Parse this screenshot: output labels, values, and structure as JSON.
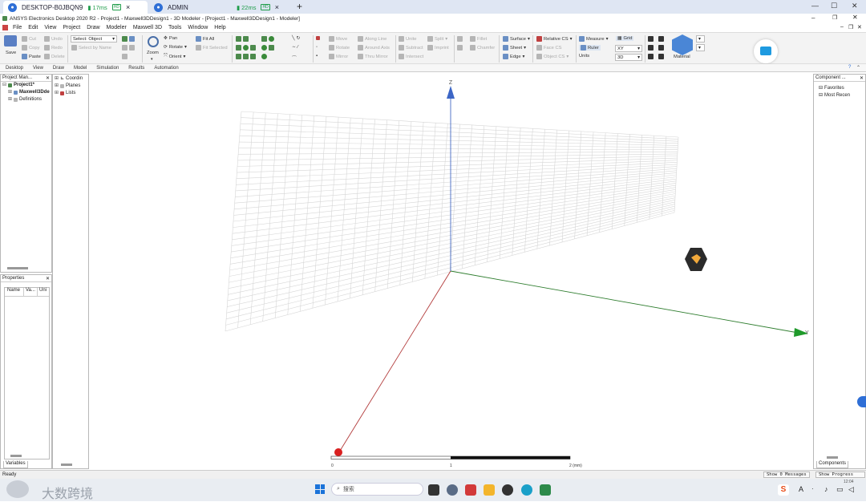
{
  "remote_tabs": [
    {
      "label": "DESKTOP-B0JBQN9",
      "ping": "17ms",
      "quality": "HD",
      "close": "×"
    },
    {
      "label": "ADMIN",
      "ping": "22ms",
      "quality": "HD",
      "close": "×"
    }
  ],
  "new_tab": "+",
  "window_title": "ANSYS Electronics Desktop 2020 R2 - Project1 - Maxwell3DDesign1 - 3D Modeler - [Project1 - Maxwell3DDesign1 - Modeler]",
  "menu": [
    "File",
    "Edit",
    "View",
    "Project",
    "Draw",
    "Modeler",
    "Maxwell 3D",
    "Tools",
    "Window",
    "Help"
  ],
  "ribbon": {
    "save": "Save",
    "cut": "Cut",
    "copy": "Copy",
    "paste": "Paste",
    "undo": "Undo",
    "redo": "Redo",
    "delete": "Delete",
    "select_mode": "Select: Object",
    "select_by_name": "Select by Name",
    "zoom": "Zoom",
    "pan": "Pan",
    "rotate": "Rotate",
    "orient": "Orient",
    "fit_all": "Fit All",
    "fit_selected": "Fit Selected",
    "move": "Move",
    "rotate2": "Rotate",
    "mirror": "Mirror",
    "along_line": "Along Line",
    "around_axis": "Around Axis",
    "thru_mirror": "Thru Mirror",
    "unite": "Unite",
    "subtract": "Subtract",
    "intersect": "Intersect",
    "split": "Split",
    "imprint": "Imprint",
    "fillet": "Fillet",
    "chamfer": "Chamfer",
    "surface": "Surface",
    "sheet": "Sheet",
    "edge": "Edge",
    "relative_cs": "Relative CS",
    "face_cs": "Face CS",
    "object_cs": "Object CS",
    "measure": "Measure",
    "ruler": "Ruler",
    "units": "Units",
    "grid": "Grid",
    "plane": "XY",
    "dim": "3D",
    "material": "Material"
  },
  "ribbon_tabs": [
    "Desktop",
    "View",
    "Draw",
    "Model",
    "Simulation",
    "Results",
    "Automation"
  ],
  "project_manager": {
    "title": "Project Man...",
    "items": [
      "Project1*",
      "Maxwell3Dde",
      "Definitions"
    ]
  },
  "model_tree": [
    "Coordin",
    "Planes",
    "Lists"
  ],
  "properties": {
    "title": "Properties",
    "columns": [
      "Name",
      "Va...",
      "Uni"
    ],
    "tab": "Variables"
  },
  "components": {
    "title": "Component ...",
    "items": [
      "Favorites",
      "Most Recen"
    ],
    "tab": "Components"
  },
  "axes": {
    "z": "Z",
    "y": "Y"
  },
  "scale": {
    "ticks": [
      "0",
      "1",
      "2 (mm)"
    ]
  },
  "status": {
    "text": "Ready",
    "messages_btn": "Show 0 Messages",
    "progress_btn": "Show Progress"
  },
  "taskbar": {
    "search_placeholder": "搜索",
    "watermark": "大数跨境",
    "time": "12:04"
  }
}
